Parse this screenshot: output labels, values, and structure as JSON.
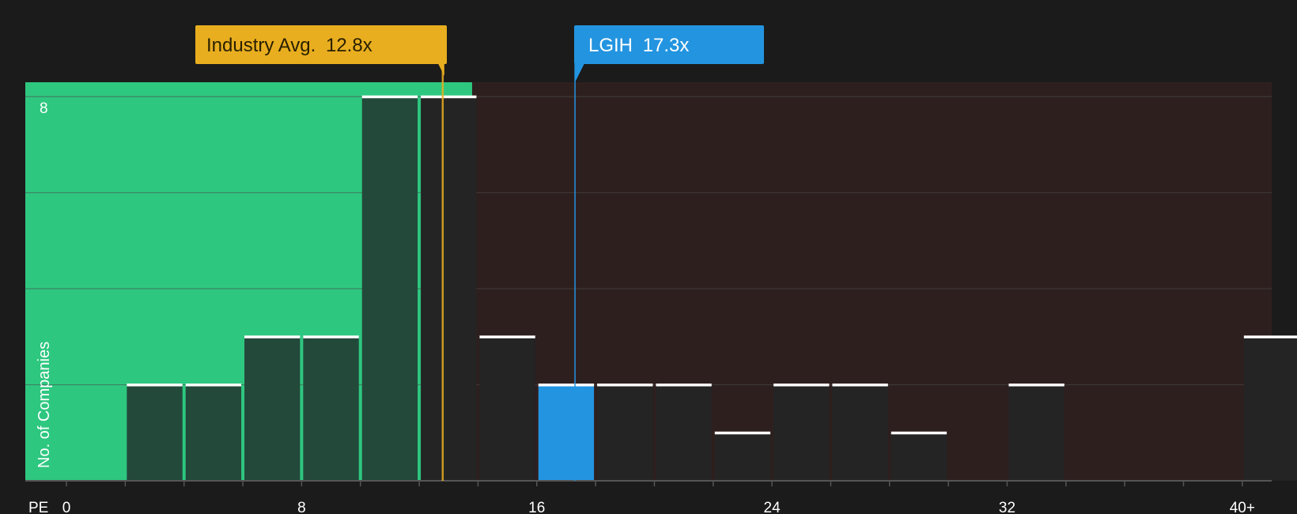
{
  "colors": {
    "background": "#1b1b1b",
    "undervalued_zone": "#2ec780",
    "overvalued_zone": "#2e1f1f",
    "bar": "#242424",
    "bar_in_green": "#23493a",
    "bar_cap": "#ffffff",
    "highlight_bar": "#2394e0",
    "industry_avg": "#e8ae1f",
    "company": "#2394e0",
    "grid": "#4a4a4a"
  },
  "callouts": {
    "industry_label": "Industry Avg.",
    "industry_value": "12.8x",
    "company_label": "LGIH",
    "company_value": "17.3x"
  },
  "chart_data": {
    "type": "bar",
    "title": "",
    "xlabel": "PE",
    "ylabel": "No. of Companies",
    "x_ticks": [
      {
        "value": 0,
        "label": "0"
      },
      {
        "value": 8,
        "label": "8"
      },
      {
        "value": 16,
        "label": "16"
      },
      {
        "value": 24,
        "label": "24"
      },
      {
        "value": 32,
        "label": "32"
      },
      {
        "value": 40,
        "label": "40+"
      }
    ],
    "y_ticks": [
      {
        "value": 8,
        "label": "8"
      }
    ],
    "xlim": [
      -1.4,
      41.0
    ],
    "ylim": [
      0,
      8.3
    ],
    "bins": [
      {
        "from": 2,
        "to": 4,
        "count": 2
      },
      {
        "from": 4,
        "to": 6,
        "count": 2
      },
      {
        "from": 6,
        "to": 8,
        "count": 3
      },
      {
        "from": 8,
        "to": 10,
        "count": 3
      },
      {
        "from": 10,
        "to": 12,
        "count": 8
      },
      {
        "from": 12,
        "to": 14,
        "count": 8
      },
      {
        "from": 14,
        "to": 16,
        "count": 3
      },
      {
        "from": 16,
        "to": 18,
        "count": 2,
        "highlight": true
      },
      {
        "from": 18,
        "to": 20,
        "count": 2
      },
      {
        "from": 20,
        "to": 22,
        "count": 2
      },
      {
        "from": 22,
        "to": 24,
        "count": 1
      },
      {
        "from": 24,
        "to": 26,
        "count": 2
      },
      {
        "from": 26,
        "to": 28,
        "count": 2
      },
      {
        "from": 28,
        "to": 30,
        "count": 1
      },
      {
        "from": 32,
        "to": 34,
        "count": 2
      },
      {
        "from": 40,
        "to": 42,
        "count": 3
      }
    ],
    "industry_avg": 12.8,
    "company_pe": 17.3,
    "company": "LGIH",
    "undervalued_threshold": 13.8
  }
}
